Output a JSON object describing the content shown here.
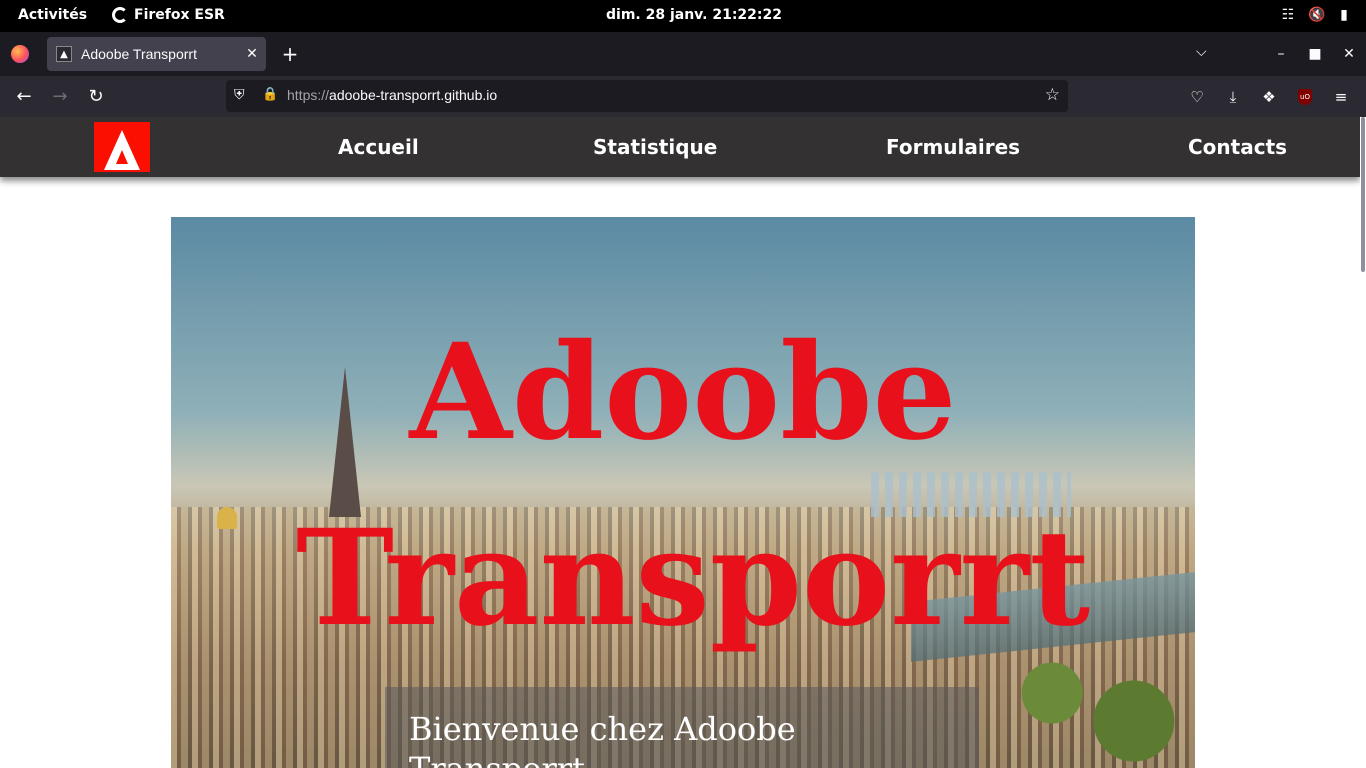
{
  "system": {
    "activities": "Activités",
    "app_name": "Firefox ESR",
    "clock": "dim. 28 janv.  21:22:22"
  },
  "browser": {
    "tab_title": "Adoobe Transporrt",
    "url_protocol": "https://",
    "url_host": "adoobe-transporrt.github.io"
  },
  "site": {
    "nav": [
      "Accueil",
      "Statistique",
      "Formulaires",
      "Contacts"
    ],
    "hero_line1": "Adoobe",
    "hero_line2": "Transporrt",
    "welcome": "Bienvenue chez Adoobe Transporrt,"
  },
  "colors": {
    "brand_red": "#e8101a",
    "site_nav_bg": "#333131"
  },
  "icons": {
    "firefox": "firefox-icon",
    "shield": "shield-icon",
    "lock": "lock-icon",
    "star": "bookmark-star-icon"
  }
}
